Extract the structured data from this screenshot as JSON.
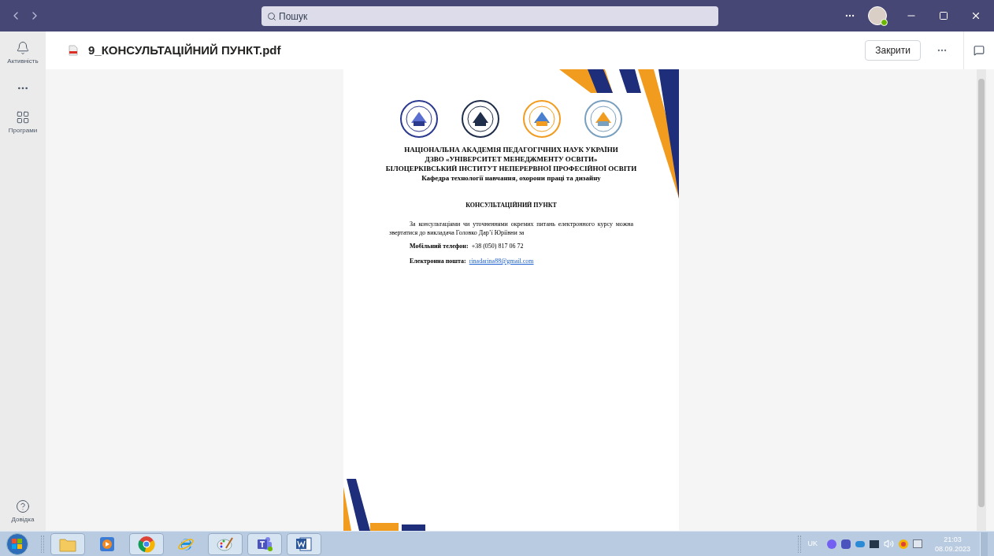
{
  "titlebar": {
    "search_placeholder": "Пошук"
  },
  "rail": [
    {
      "kind": "bell",
      "label": "Активність"
    },
    {
      "kind": "more"
    },
    {
      "kind": "apps",
      "label": "Програми"
    },
    {
      "kind": "help",
      "label": "Довідка"
    }
  ],
  "header": {
    "file_name": "9_КОНСУЛЬТАЦІЙНИЙ ПУНКТ.pdf",
    "close_button": "Закрити"
  },
  "document": {
    "org_lines": [
      "НАЦІОНАЛЬНА АКАДЕМІЯ ПЕДАГОГІЧНИХ НАУК УКРАЇНИ",
      "ДЗВО «УНІВЕРСИТЕТ МЕНЕДЖМЕНТУ ОСВІТИ»",
      "БІЛОЦЕРКІВСЬКИЙ ІНСТИТУТ НЕПЕРЕРВНОЇ ПРОФЕСІЙНОЇ ОСВІТИ"
    ],
    "department": "Кафедра технології навчання, охорони праці та дизайну",
    "heading": "КОНСУЛЬТАЦІЙНИЙ ПУНКТ",
    "paragraph": "За консультаціями чи уточненнями окремих питань електронного курсу можна звертатися до викладача Головко Дар’ї Юріївни за",
    "phone_label": "Мобільний телефон:",
    "phone": "+38 (050) 817 06 72",
    "email_label": "Електронна пошта:",
    "email": "rinadarina88@gmail.com"
  },
  "taskbar": {
    "apps": [
      {
        "kind": "explorer",
        "running": true
      },
      {
        "kind": "media",
        "running": false
      },
      {
        "kind": "chrome",
        "running": true
      },
      {
        "kind": "ie",
        "running": false
      },
      {
        "kind": "paint",
        "running": true
      },
      {
        "kind": "teams",
        "running": true
      },
      {
        "kind": "word",
        "running": true
      }
    ],
    "language": "UK",
    "time": "21:03",
    "date": "08.09.2023"
  }
}
